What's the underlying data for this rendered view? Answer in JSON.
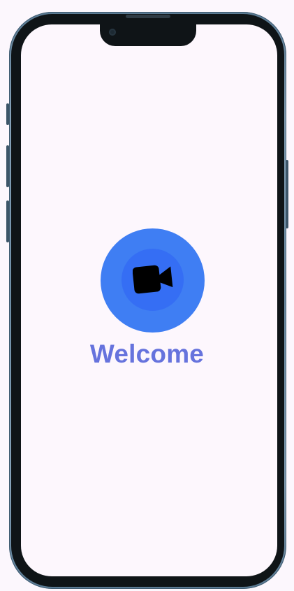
{
  "welcome": {
    "title": "Welcome",
    "icon": "video-camera-icon"
  },
  "colors": {
    "background": "#fcf7fd",
    "accent_outer": "#3f7ef3",
    "accent_inner": "#356ef4",
    "title": "#6673dd",
    "device_frame": "#0f1417"
  }
}
